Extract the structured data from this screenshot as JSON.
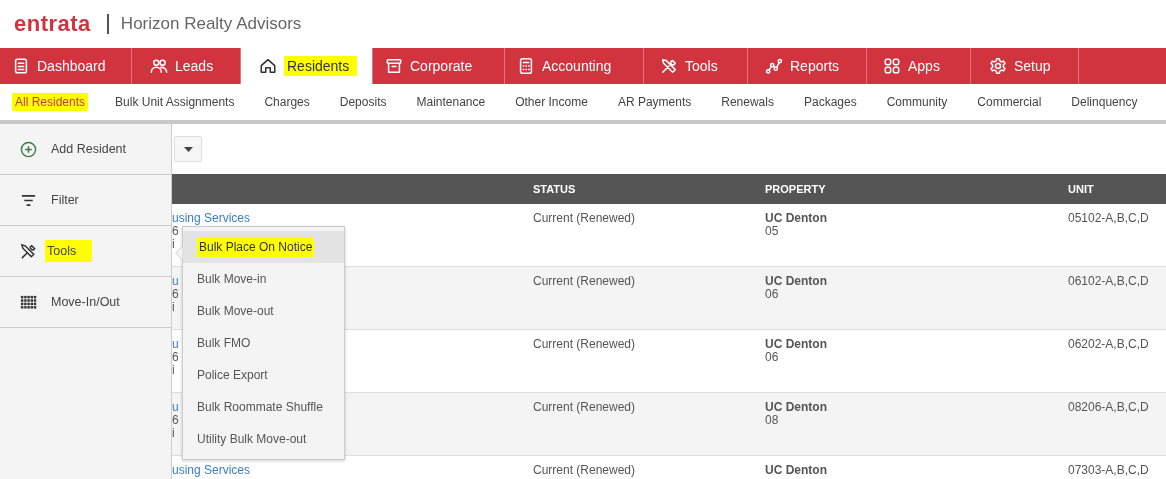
{
  "header": {
    "logo": "entrata",
    "company": "Horizon Realty Advisors"
  },
  "nav_tabs": [
    {
      "label": "Dashboard",
      "kind": "clipboard",
      "selected": false,
      "highlighted": false
    },
    {
      "label": "Leads",
      "kind": "people",
      "selected": false,
      "highlighted": false
    },
    {
      "label": "Residents",
      "kind": "house",
      "selected": true,
      "highlighted": true
    },
    {
      "label": "Corporate",
      "kind": "archive",
      "selected": false,
      "highlighted": false
    },
    {
      "label": "Accounting",
      "kind": "calculator",
      "selected": false,
      "highlighted": false
    },
    {
      "label": "Tools",
      "kind": "tools",
      "selected": false,
      "highlighted": false
    },
    {
      "label": "Reports",
      "kind": "chart",
      "selected": false,
      "highlighted": false
    },
    {
      "label": "Apps",
      "kind": "apps",
      "selected": false,
      "highlighted": false
    },
    {
      "label": "Setup",
      "kind": "gear",
      "selected": false,
      "highlighted": false
    }
  ],
  "sub_nav": [
    {
      "label": "All Residents",
      "selected": true,
      "highlighted": true
    },
    {
      "label": "Bulk Unit Assignments",
      "selected": false,
      "highlighted": false
    },
    {
      "label": "Charges",
      "selected": false,
      "highlighted": false
    },
    {
      "label": "Deposits",
      "selected": false,
      "highlighted": false
    },
    {
      "label": "Maintenance",
      "selected": false,
      "highlighted": false
    },
    {
      "label": "Other Income",
      "selected": false,
      "highlighted": false
    },
    {
      "label": "AR Payments",
      "selected": false,
      "highlighted": false
    },
    {
      "label": "Renewals",
      "selected": false,
      "highlighted": false
    },
    {
      "label": "Packages",
      "selected": false,
      "highlighted": false
    },
    {
      "label": "Community",
      "selected": false,
      "highlighted": false
    },
    {
      "label": "Commercial",
      "selected": false,
      "highlighted": false
    },
    {
      "label": "Delinquency",
      "selected": false,
      "highlighted": false
    }
  ],
  "sidebar": [
    {
      "label": "Add Resident",
      "kind": "add",
      "highlighted": false
    },
    {
      "label": "Filter",
      "kind": "filter",
      "highlighted": false
    },
    {
      "label": "Tools",
      "kind": "tools",
      "highlighted": true
    },
    {
      "label": "Move-In/Out",
      "kind": "grid",
      "highlighted": false
    }
  ],
  "table": {
    "columns": [
      "STATUS",
      "PROPERTY",
      "UNIT"
    ],
    "rows": [
      {
        "column_1": [
          "using Services",
          "6",
          "i"
        ],
        "status": "Current (Renewed)",
        "property": "UC Denton",
        "property_line2": "05",
        "unit": "05102-A,B,C,D"
      },
      {
        "column_1": [
          "u",
          "6",
          "i"
        ],
        "status": "Current (Renewed)",
        "property": "UC Denton",
        "property_line2": "06",
        "unit": "06102-A,B,C,D"
      },
      {
        "column_1": [
          "u",
          "6",
          "i"
        ],
        "status": "Current (Renewed)",
        "property": "UC Denton",
        "property_line2": "06",
        "unit": "06202-A,B,C,D"
      },
      {
        "column_1": [
          "u",
          "6",
          "i"
        ],
        "status": "Current (Renewed)",
        "property": "UC Denton",
        "property_line2": "08",
        "unit": "08206-A,B,C,D"
      },
      {
        "column_1": [
          "using Services"
        ],
        "status": "Current (Renewed)",
        "property": "UC Denton",
        "unit": "07303-A,B,C,D"
      }
    ]
  },
  "tools_menu": {
    "items": [
      {
        "label": "Bulk Place On Notice",
        "selected": true,
        "highlighted": true
      },
      {
        "label": "Bulk Move-in",
        "selected": false,
        "highlighted": false
      },
      {
        "label": "Bulk Move-out",
        "selected": false,
        "highlighted": false
      },
      {
        "label": "Bulk FMO",
        "selected": false,
        "highlighted": false
      },
      {
        "label": "Police Export",
        "selected": false,
        "highlighted": false
      },
      {
        "label": "Bulk Roommate Shuffle",
        "selected": false,
        "highlighted": false
      },
      {
        "label": "Utility Bulk Move-out",
        "selected": false,
        "highlighted": false
      }
    ]
  }
}
